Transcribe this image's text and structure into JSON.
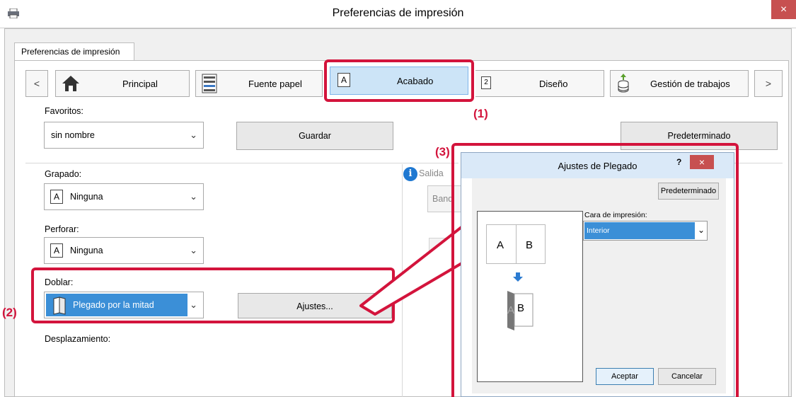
{
  "window": {
    "title": "Preferencias de impresión",
    "close": "×"
  },
  "tab_label": "Preferencias de impresión",
  "nav": {
    "prev": "<",
    "next": ">",
    "items": [
      {
        "label": "Principal",
        "icon": "home-icon"
      },
      {
        "label": "Fuente papel",
        "icon": "paper-tray-icon"
      },
      {
        "label": "Acabado",
        "icon": "finishing-page-icon"
      },
      {
        "label": "Diseño",
        "icon": "layout-page-icon"
      },
      {
        "label": "Gestión de trabajos",
        "icon": "job-stack-icon"
      }
    ]
  },
  "favorites": {
    "label": "Favoritos:",
    "value": "sin nombre",
    "save": "Guardar",
    "default": "Predeterminado"
  },
  "stapling": {
    "label": "Grapado:",
    "value": "Ninguna"
  },
  "punch": {
    "label": "Perforar:",
    "value": "Ninguna"
  },
  "fold": {
    "label": "Doblar:",
    "value": "Plegado por la mitad",
    "settings": "Ajustes..."
  },
  "offset": {
    "label": "Desplazamiento:"
  },
  "output": {
    "label": "Salida",
    "tray": "Band"
  },
  "dialog": {
    "title": "Ajustes de Plegado",
    "help": "?",
    "close": "×",
    "default": "Predeterminado",
    "print_side_label": "Cara de impresión:",
    "print_side_value": "Interior",
    "preview_before": [
      "A",
      "B"
    ],
    "preview_after": [
      "A",
      "B"
    ],
    "ok": "Aceptar",
    "cancel": "Cancelar"
  },
  "callouts": {
    "c1": "(1)",
    "c2": "(2)",
    "c3": "(3)"
  },
  "colors": {
    "accent": "#d3143c",
    "selection": "#3b8fd7",
    "active_tab": "#cce4f7"
  }
}
